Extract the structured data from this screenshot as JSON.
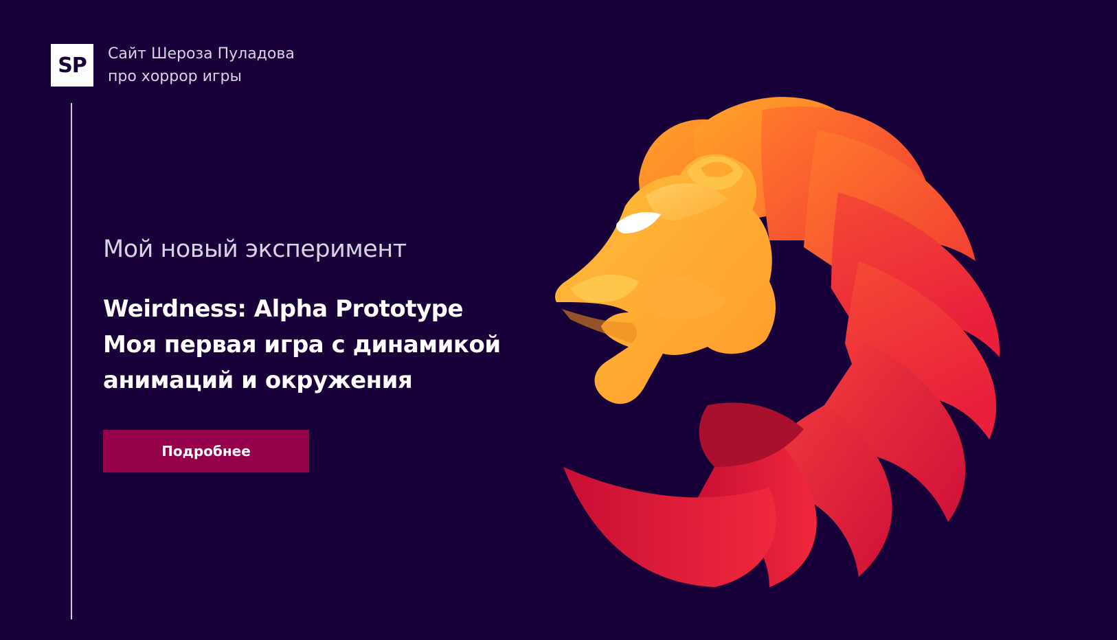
{
  "header": {
    "logo_text": "SP",
    "site_title_line1": "Сайт Шероза Пуладова",
    "site_title_line2": "про хоррор игры"
  },
  "hero": {
    "subtitle": "Мой новый эксперимент",
    "headline_line1": "Weirdness: Alpha Prototype",
    "headline_line2": "Моя первая игра с динамикой",
    "headline_line3": "анимаций и окружения",
    "cta_label": "Подробнее"
  },
  "colors": {
    "background": "#180038",
    "cta": "#95004a",
    "text_primary": "#ffffff",
    "text_secondary": "#d8d3e4",
    "lion_orange": "#ffb030",
    "lion_red": "#e8203a"
  },
  "illustration": {
    "name": "lion-head-icon"
  }
}
